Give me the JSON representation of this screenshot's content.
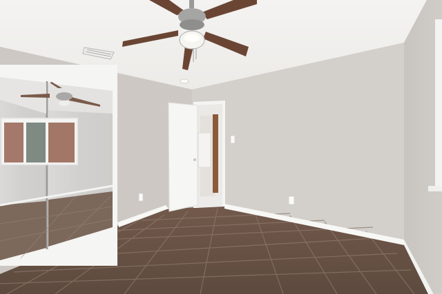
{
  "scene": {
    "kind": "photo",
    "subject": "empty-bedroom-interior",
    "colors": {
      "ceiling": "#f1f0ee",
      "wall_left": "#cfcac6",
      "wall_back": "#d2ceca",
      "wall_right": "#c9c5c1",
      "floor_tile": "#6b5548",
      "grout": "#8a7668",
      "baseboard": "#f7f7f5",
      "door": "#f6f6f4",
      "fan_blade": "#6b4534",
      "fan_metal": "#9a9a98",
      "mirror_tint": "#d9d8d6"
    },
    "icons": [
      "ceiling-fan-icon",
      "air-vent-icon",
      "smoke-detector-icon",
      "light-switch-icon",
      "outlet-icon"
    ]
  }
}
